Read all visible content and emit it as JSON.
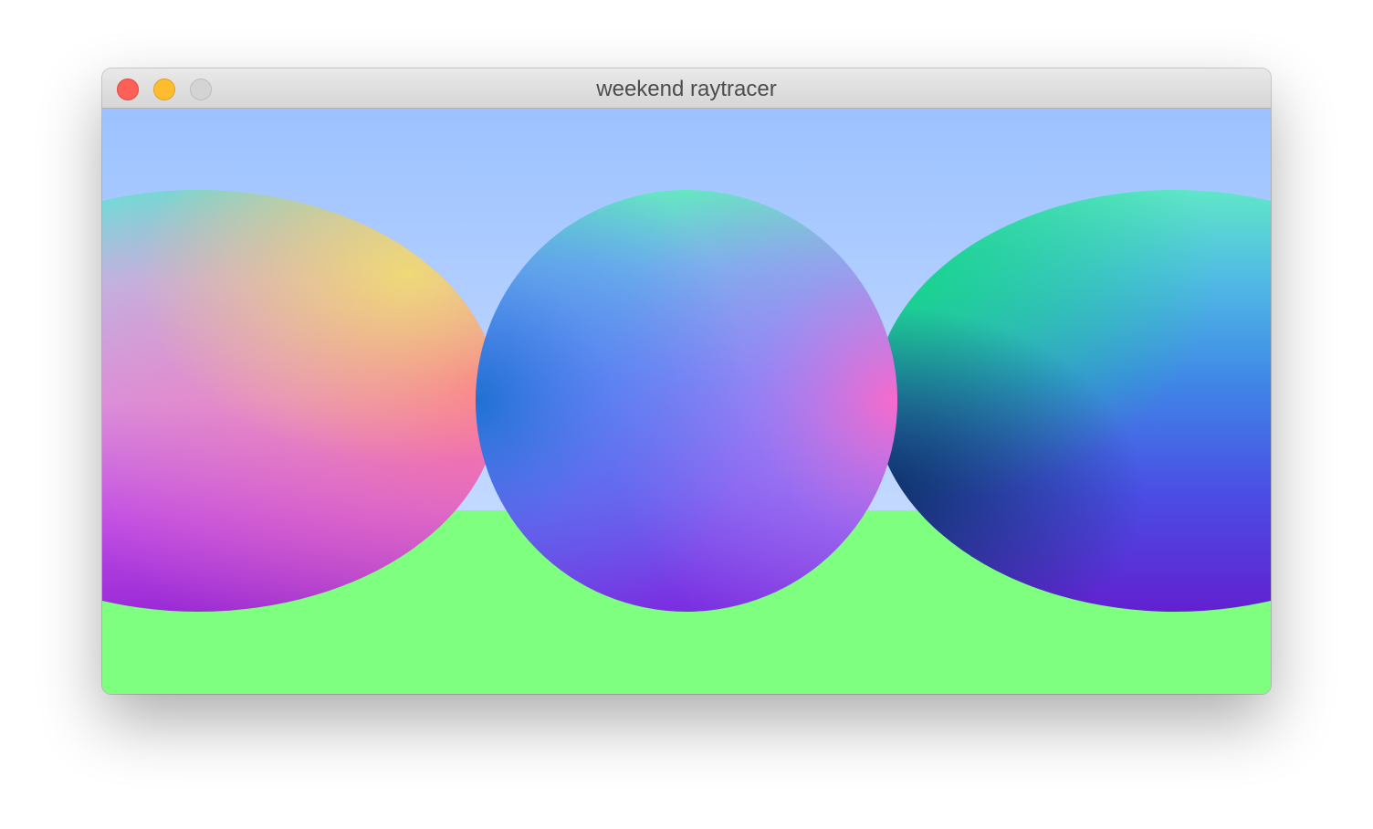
{
  "window": {
    "title": "weekend raytracer",
    "controls": {
      "close": "close-icon",
      "minimize": "minimize-icon",
      "zoom": "zoom-icon"
    }
  },
  "render": {
    "sky_colors": [
      "#9cc2ff",
      "#b6d1ff"
    ],
    "ground_color": "#7fff80",
    "spheres": 3
  }
}
